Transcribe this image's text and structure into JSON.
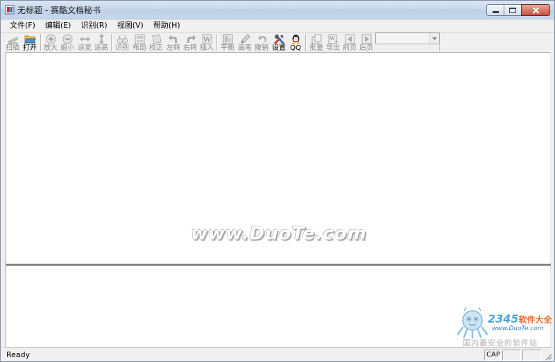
{
  "window": {
    "title": "无标题 - 赛酷文档秘书"
  },
  "menu": [
    {
      "label": "文件(F)"
    },
    {
      "label": "编辑(E)"
    },
    {
      "label": "识别(R)"
    },
    {
      "label": "视图(V)"
    },
    {
      "label": "帮助(H)"
    }
  ],
  "toolbar": {
    "scan": "扫描",
    "open": "打开",
    "zoom_in": "放大",
    "zoom_out": "缩小",
    "fit_width": "适宽",
    "fit_height": "适高",
    "recognize": "识别",
    "layout": "布局",
    "correct": "校正",
    "rotate_left": "左转",
    "rotate_right": "右转",
    "insert": "插入",
    "balance": "平衡",
    "brush": "画笔",
    "undo": "撤销",
    "settings": "设置",
    "qq": "QQ",
    "batch": "批量",
    "export": "导出",
    "prev_page": "前页",
    "next_page": "后页",
    "combo_value": ""
  },
  "watermark": "www.DuoTe.com",
  "logo": {
    "num": "2345",
    "brand": "软件大全",
    "url": "www.DuoTe.com",
    "slogan": "国内最安全的软件站"
  },
  "status": {
    "text": "Ready",
    "cap": "CAP",
    "num": "",
    "scrl": ""
  },
  "colors": {
    "close_button": "#c9503b",
    "titlebar": "#c7d7ea"
  }
}
